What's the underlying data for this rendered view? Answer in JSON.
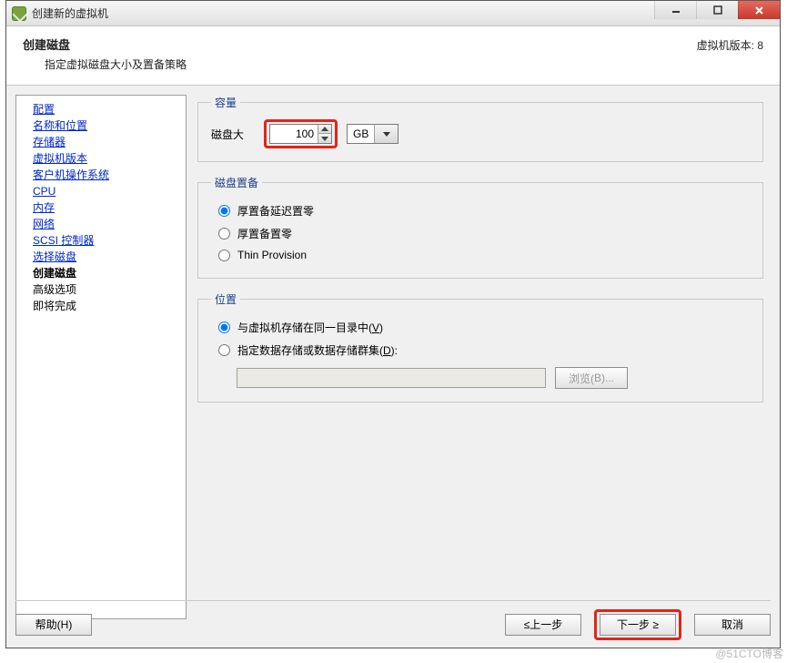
{
  "window": {
    "title": "创建新的虚拟机"
  },
  "header": {
    "title": "创建磁盘",
    "subtitle": "指定虚拟磁盘大小及置备策略",
    "version": "虚拟机版本: 8"
  },
  "sidebar": {
    "items": [
      {
        "label": "配置",
        "type": "link"
      },
      {
        "label": "名称和位置",
        "type": "link"
      },
      {
        "label": "存储器",
        "type": "link"
      },
      {
        "label": "虚拟机版本",
        "type": "link"
      },
      {
        "label": "客户机操作系统",
        "type": "link"
      },
      {
        "label": "CPU",
        "type": "link"
      },
      {
        "label": "内存",
        "type": "link"
      },
      {
        "label": "网络",
        "type": "link"
      },
      {
        "label": "SCSI 控制器",
        "type": "link"
      },
      {
        "label": "选择磁盘",
        "type": "link"
      },
      {
        "label": "创建磁盘",
        "type": "current"
      },
      {
        "label": "高级选项",
        "type": "plain"
      },
      {
        "label": "即将完成",
        "type": "plain"
      }
    ]
  },
  "capacity": {
    "legend": "容量",
    "label": "磁盘大",
    "value": "100",
    "unit_selected": "GB"
  },
  "provision": {
    "legend": "磁盘置备",
    "opts": [
      {
        "label": "厚置备延迟置零",
        "checked": true
      },
      {
        "label": "厚置备置零",
        "checked": false
      },
      {
        "label": "Thin Provision",
        "checked": false
      }
    ]
  },
  "location": {
    "legend": "位置",
    "opt_same_prefix": "与虚拟机存储在同一目录中(",
    "opt_same_hot": "V",
    "opt_same_suffix": ")",
    "opt_ds_prefix": "指定数据存储或数据存储群集(",
    "opt_ds_hot": "D",
    "opt_ds_suffix": "):",
    "browse_prefix": "浏览(",
    "browse_hot": "B",
    "browse_suffix": ")..."
  },
  "footer": {
    "help_prefix": "帮助(",
    "help_hot": "H",
    "help_suffix": ")",
    "back": "≤上一步",
    "next": "下一步 ≥",
    "cancel": "取消"
  },
  "watermark": "@51CTO博客"
}
